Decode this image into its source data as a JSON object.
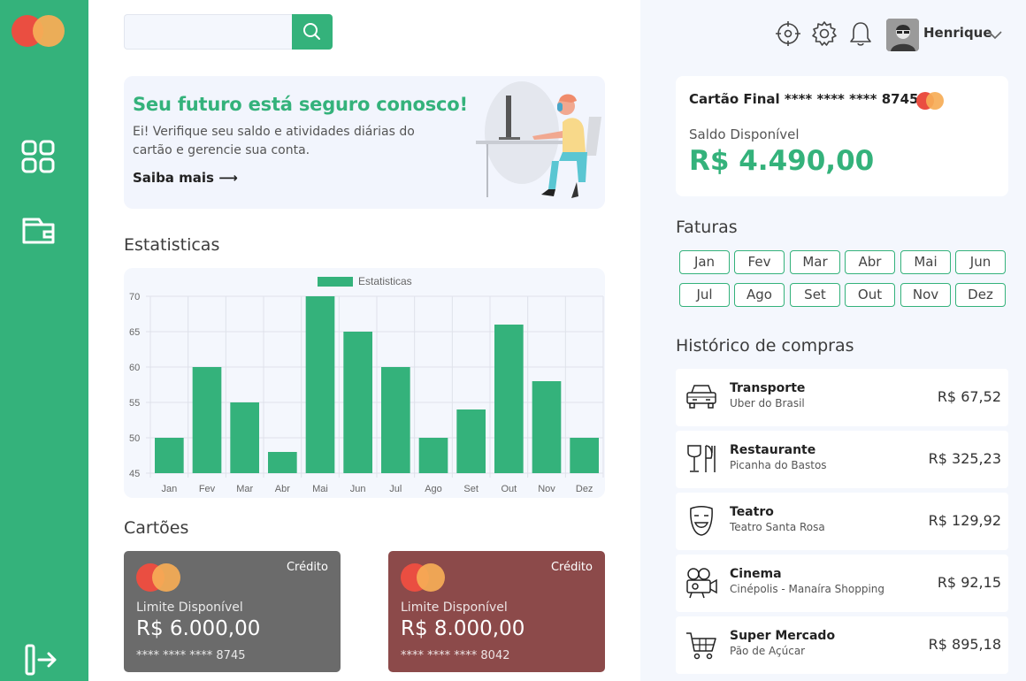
{
  "user": {
    "name": "Henrique"
  },
  "search": {
    "placeholder": ""
  },
  "hero": {
    "title": "Seu futuro está seguro conosco!",
    "text": "Ei! Verifique seu saldo e atividades diárias do cartão e gerencie sua conta.",
    "link": "Saiba mais ⟶"
  },
  "sections": {
    "stats": "Estatisticas",
    "cards": "Cartões",
    "invoices": "Faturas",
    "history": "Histórico de compras"
  },
  "chart_data": {
    "type": "bar",
    "legend": "Estatisticas",
    "categories": [
      "Jan",
      "Fev",
      "Mar",
      "Abr",
      "Mai",
      "Jun",
      "Jul",
      "Ago",
      "Set",
      "Out",
      "Nov",
      "Dez"
    ],
    "series": [
      {
        "name": "Estatisticas",
        "values": [
          50,
          60,
          55,
          48,
          70,
          65,
          60,
          50,
          54,
          66,
          58,
          50
        ]
      }
    ],
    "ylim": [
      45,
      70
    ],
    "yticks": [
      45,
      50,
      55,
      60,
      65,
      70
    ],
    "grid": true,
    "color": "#34b27b"
  },
  "cards": [
    {
      "type": "Crédito",
      "label": "Limite Disponível",
      "value": "R$ 6.000,00",
      "number": "**** **** **** 8745",
      "color": "#6b6b6b"
    },
    {
      "type": "Crédito",
      "label": "Limite Disponível",
      "value": "R$ 8.000,00",
      "number": "**** **** **** 8042",
      "color": "#8c4a4a"
    }
  ],
  "balance": {
    "title": "Cartão Final **** **** **** 8745",
    "label": "Saldo Disponível",
    "value": "R$ 4.490,00"
  },
  "months": [
    "Jan",
    "Fev",
    "Mar",
    "Abr",
    "Mai",
    "Jun",
    "Jul",
    "Ago",
    "Set",
    "Out",
    "Nov",
    "Dez"
  ],
  "purchases": [
    {
      "title": "Transporte",
      "sub": "Uber do Brasil",
      "value": "R$ 67,52",
      "icon": "car-icon"
    },
    {
      "title": "Restaurante",
      "sub": "Picanha do Bastos",
      "value": "R$ 325,23",
      "icon": "dining-icon"
    },
    {
      "title": "Teatro",
      "sub": "Teatro Santa Rosa",
      "value": "R$ 129,92",
      "icon": "theater-mask-icon"
    },
    {
      "title": "Cinema",
      "sub": "Cinépolis - Manaíra Shopping",
      "value": "R$ 92,15",
      "icon": "film-camera-icon"
    },
    {
      "title": "Super Mercado",
      "sub": "Pão de Açúcar",
      "value": "R$ 895,18",
      "icon": "shopping-cart-icon"
    }
  ],
  "colors": {
    "accent": "#34b27b",
    "panel": "#f4f7fd"
  }
}
